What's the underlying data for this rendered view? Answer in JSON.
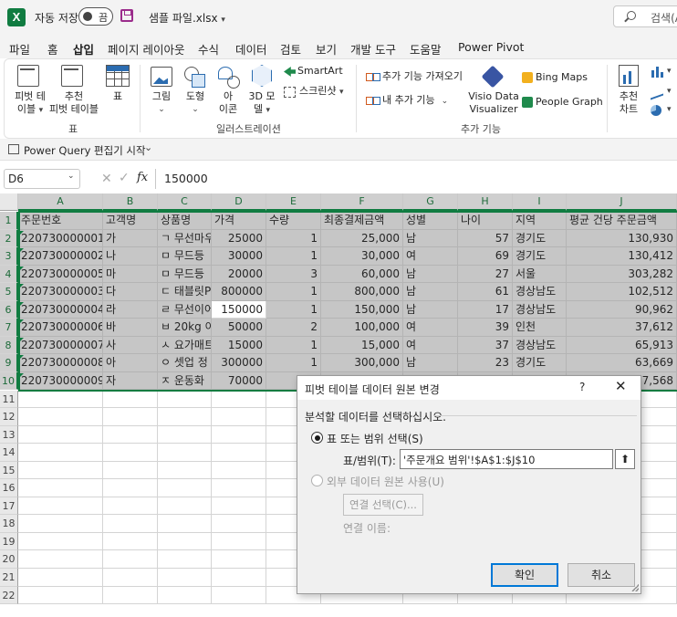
{
  "titlebar": {
    "logo": "X",
    "autosave_label": "자동 저장",
    "autosave_state": "끔",
    "filename": "샘플 파일.xlsx",
    "search_text": "검색(A"
  },
  "tabs": [
    "파일",
    "홈",
    "삽입",
    "페이지 레이아웃",
    "수식",
    "데이터",
    "검토",
    "보기",
    "개발 도구",
    "도움말",
    "Power Pivot"
  ],
  "active_tab": "삽입",
  "ribbon": {
    "pivot_table": "피벗 테\n이블",
    "pivot_line1": "피벗 테",
    "pivot_line2": "이블",
    "rec_pivot_line1": "추천",
    "rec_pivot_line2": "피벗 테이블",
    "table": "표",
    "group_table": "표",
    "picture": "그림",
    "shapes": "도형",
    "icons_line1": "아",
    "icons_line2": "이콘",
    "model3d_line1": "3D 모",
    "model3d_line2": "델",
    "smartart": "SmartArt",
    "screenshot": "스크린샷",
    "group_illustrations": "일러스트레이션",
    "get_addins": "추가 기능 가져오기",
    "my_addins": "내 추가 기능",
    "visio_line1": "Visio Data",
    "visio_line2": "Visualizer",
    "bing_maps": "Bing Maps",
    "people_graph": "People Graph",
    "group_addins": "추가 기능",
    "rec_chart_line1": "추천",
    "rec_chart_line2": "차트"
  },
  "quickbar": {
    "power_query": "Power Query 편집기 시작"
  },
  "formula_bar": {
    "name_box": "D6",
    "fx": "fx",
    "value": "150000"
  },
  "columns": [
    "A",
    "B",
    "C",
    "D",
    "E",
    "F",
    "G",
    "H",
    "I",
    "J"
  ],
  "header_row": [
    "주문번호",
    "고객명",
    "상품명",
    "가격",
    "수량",
    "최종결제금액",
    "성별",
    "나이",
    "지역",
    "평균 건당 주문금액"
  ],
  "rows": [
    [
      "220730000001",
      "가",
      "ㄱ 무선마우",
      "25000",
      "1",
      "25,000",
      "남",
      "57",
      "경기도",
      "130,930"
    ],
    [
      "220730000002",
      "나",
      "ㅁ 무드등",
      "30000",
      "1",
      "30,000",
      "여",
      "69",
      "경기도",
      "130,412"
    ],
    [
      "220730000005",
      "마",
      "ㅁ 무드등",
      "20000",
      "3",
      "60,000",
      "남",
      "27",
      "서울",
      "303,282"
    ],
    [
      "220730000003",
      "다",
      "ㄷ 태블릿P",
      "800000",
      "1",
      "800,000",
      "남",
      "61",
      "경상남도",
      "102,512"
    ],
    [
      "220730000004",
      "라",
      "ㄹ 무선이어",
      "150000",
      "1",
      "150,000",
      "남",
      "17",
      "경상남도",
      "90,962"
    ],
    [
      "220730000006",
      "바",
      "ㅂ 20kg 이",
      "50000",
      "2",
      "100,000",
      "여",
      "39",
      "인천",
      "37,612"
    ],
    [
      "220730000007",
      "사",
      "ㅅ 요가매트",
      "15000",
      "1",
      "15,000",
      "여",
      "37",
      "경상남도",
      "65,913"
    ],
    [
      "220730000008",
      "아",
      "ㅇ 셋업 정",
      "300000",
      "1",
      "300,000",
      "남",
      "23",
      "경기도",
      "63,669"
    ],
    [
      "220730000009",
      "자",
      "ㅈ 운동화",
      "70000",
      "1",
      "70,000",
      "",
      "",
      "",
      "77,568"
    ]
  ],
  "row_numbers": [
    "1",
    "2",
    "3",
    "4",
    "5",
    "6",
    "7",
    "8",
    "9",
    "10",
    "11",
    "12",
    "13",
    "14",
    "15",
    "16",
    "17",
    "18",
    "19",
    "20",
    "21",
    "22"
  ],
  "dialog": {
    "title": "피벗 테이블 데이터 원본 변경",
    "help": "?",
    "close": "✕",
    "prompt": "분석할 데이터를 선택하십시오.",
    "option_range": "표 또는 범위 선택(S)",
    "range_label": "표/범위(T):",
    "range_value": "'주문개요 범위'!$A$1:$J$10",
    "range_button": "⬆",
    "option_external": "외부 데이터 원본 사용(U)",
    "choose_connection": "연결 선택(C)...",
    "connection_name": "연결 이름:",
    "ok": "확인",
    "cancel": "취소"
  }
}
